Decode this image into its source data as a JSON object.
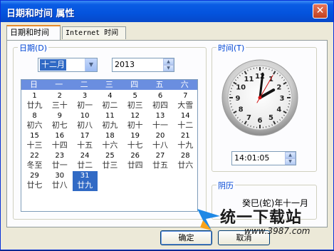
{
  "window": {
    "title": "日期和时间 属性",
    "close_glyph": "✕"
  },
  "tabs": [
    {
      "label": "日期和时间"
    },
    {
      "label": "Internet 时间"
    }
  ],
  "date_group": {
    "label": "日期(D)",
    "month_select": "十二月",
    "year_value": "2013",
    "weekdays": [
      "日",
      "一",
      "二",
      "三",
      "四",
      "五",
      "六"
    ],
    "days": [
      {
        "n": "1",
        "l": "廿九"
      },
      {
        "n": "2",
        "l": "三十"
      },
      {
        "n": "3",
        "l": "初一"
      },
      {
        "n": "4",
        "l": "初二"
      },
      {
        "n": "5",
        "l": "初三"
      },
      {
        "n": "6",
        "l": "初四"
      },
      {
        "n": "7",
        "l": "大雪"
      },
      {
        "n": "8",
        "l": "初六"
      },
      {
        "n": "9",
        "l": "初七"
      },
      {
        "n": "10",
        "l": "初八"
      },
      {
        "n": "11",
        "l": "初九"
      },
      {
        "n": "12",
        "l": "初十"
      },
      {
        "n": "13",
        "l": "十一"
      },
      {
        "n": "14",
        "l": "十二"
      },
      {
        "n": "15",
        "l": "十三"
      },
      {
        "n": "16",
        "l": "十四"
      },
      {
        "n": "17",
        "l": "十五"
      },
      {
        "n": "18",
        "l": "十六"
      },
      {
        "n": "19",
        "l": "十七"
      },
      {
        "n": "20",
        "l": "十八"
      },
      {
        "n": "21",
        "l": "十九"
      },
      {
        "n": "22",
        "l": "冬至"
      },
      {
        "n": "23",
        "l": "廿一"
      },
      {
        "n": "24",
        "l": "廿二"
      },
      {
        "n": "25",
        "l": "廿三"
      },
      {
        "n": "26",
        "l": "廿四"
      },
      {
        "n": "27",
        "l": "廿五"
      },
      {
        "n": "28",
        "l": "廿六"
      },
      {
        "n": "29",
        "l": "廿七"
      },
      {
        "n": "30",
        "l": "廿八"
      },
      {
        "n": "31",
        "l": "廿九"
      }
    ],
    "selected_day": "31"
  },
  "time_group": {
    "label": "时间(T)",
    "time_value": "14:01:05",
    "clock": {
      "hour": 14,
      "minute": 1,
      "second": 5,
      "numerals": [
        "12",
        "1",
        "2",
        "3",
        "4",
        "5",
        "6",
        "7",
        "8",
        "9",
        "10",
        "11"
      ]
    }
  },
  "lunar_group": {
    "label": "阴历",
    "year_text": "癸巳(蛇)年",
    "month_text": "十一月"
  },
  "buttons": {
    "ok": "确定",
    "cancel": "取消"
  },
  "watermark": {
    "text": "统一下载站",
    "url": "www.3987.com"
  },
  "colors": {
    "accent": "#316ac5",
    "calendar_header": "#6a8ee0",
    "group_label": "#0046d5"
  }
}
